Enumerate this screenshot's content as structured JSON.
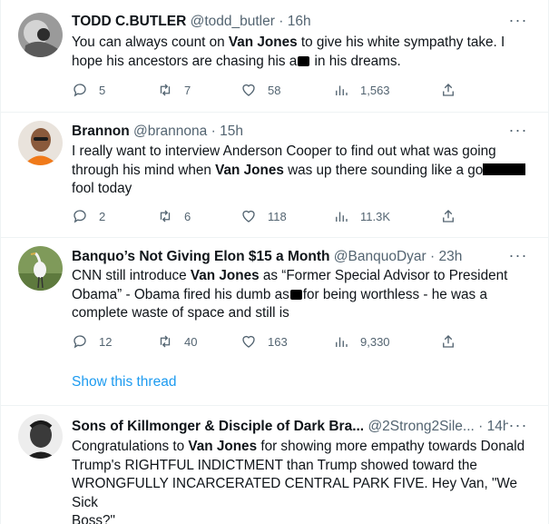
{
  "tweets": [
    {
      "name": "TODD C.BUTLER",
      "handle": "@todd_butler",
      "sep": "·",
      "time": "16h",
      "body": {
        "l1_pre": "You can always count on ",
        "l1_bold": "Van Jones",
        "l1_post": " to give his white sympathy take. I",
        "l2_pre": "hope his ancestors are chasing his a",
        "l2_post": " in his dreams."
      },
      "replies": "5",
      "retweets": "7",
      "likes": "58",
      "views": "1,563"
    },
    {
      "name": "Brannon",
      "handle": "@brannona",
      "sep": "·",
      "time": "15h",
      "body": {
        "l1": "I really want to interview Anderson Cooper to find out what was going",
        "l2_pre": "through his mind when ",
        "l2_bold": "Van Jones",
        "l2_post": " was up there sounding like a go",
        "l3": "fool today"
      },
      "replies": "2",
      "retweets": "6",
      "likes": "118",
      "views": "11.3K"
    },
    {
      "name": "Banquo’s Not Giving Elon $15 a Month",
      "handle": "@BanquoDyar",
      "sep": "·",
      "time": "23h",
      "body": {
        "l1_pre": "CNN still introduce ",
        "l1_bold": "Van Jones",
        "l1_post": " as “Former Special Advisor to President",
        "l2_pre": "Obama” - Obama fired his dumb as",
        "l2_post": "for being worthless - he was a",
        "l3": "complete waste of space and still is"
      },
      "replies": "12",
      "retweets": "40",
      "likes": "163",
      "views": "9,330",
      "show_thread": "Show this thread"
    },
    {
      "name": "Sons of Killmonger & Disciple of Dark Bra...",
      "handle": "@2Strong2Sile...",
      "sep": "·",
      "time": "14h",
      "body": {
        "l1_pre": "Congratulations to ",
        "l1_bold": "Van Jones",
        "l1_post": " for showing more empathy towards Donald",
        "l2": "Trump's RIGHTFUL INDICTMENT than Trump showed toward the",
        "l3": "WRONGFULLY INCARCERATED CENTRAL PARK FIVE. Hey Van, \"We Sick",
        "l4": "Boss?\""
      }
    }
  ],
  "more_glyph": "···",
  "icons": [
    "reply-icon",
    "retweet-icon",
    "like-icon",
    "views-icon",
    "share-icon",
    "more-icon"
  ],
  "colors": {
    "link": "#1d9bf0",
    "muted": "#536471",
    "text": "#0f1419",
    "divider": "#eff3f4"
  }
}
